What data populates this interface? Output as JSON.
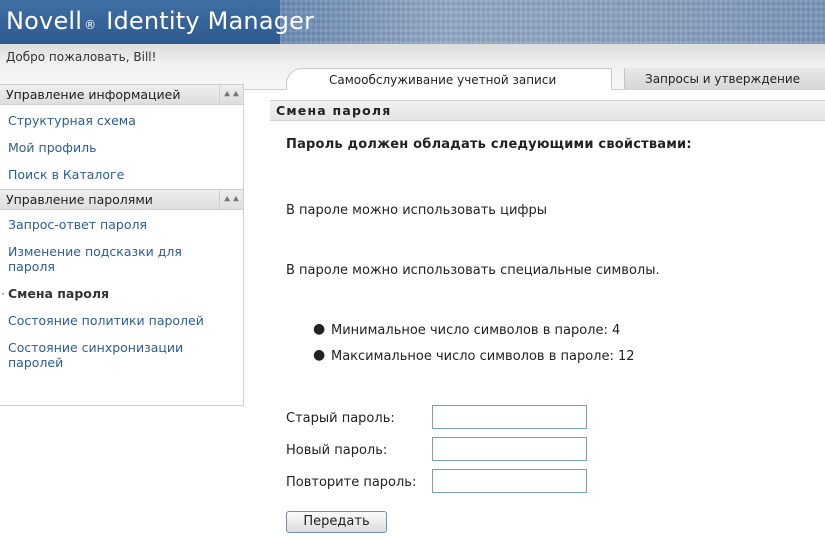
{
  "header": {
    "brand_name": "Novell",
    "brand_reg": "®",
    "brand_product": "Identity Manager"
  },
  "welcome": "Добро пожаловать, Bill!",
  "tabs": [
    {
      "label": "Самообслуживание учетной записи",
      "active": true
    },
    {
      "label": "Запросы и утверждение",
      "active": false
    }
  ],
  "sidebar": {
    "sections": [
      {
        "title": "Управление информацией",
        "items": [
          "Структурная схема",
          "Мой профиль",
          "Поиск в Каталоге"
        ]
      },
      {
        "title": "Управление паролями",
        "items": [
          "Запрос-ответ пароля",
          "Изменение подсказки для пароля",
          "Смена пароля",
          "Состояние политики паролей",
          "Состояние синхронизации паролей"
        ]
      }
    ],
    "current_item": "Смена пароля"
  },
  "panel": {
    "title": "Смена пароля",
    "requirements_heading": "Пароль должен обладать следующими свойствами:",
    "rule_digits": "В пароле можно использовать цифры",
    "rule_special": "В пароле можно использовать специальные символы.",
    "bullets": [
      "Минимальное число символов в пароле: 4",
      "Максимальное число символов в пароле: 12"
    ],
    "old_password_label": "Старый пароль:",
    "new_password_label": "Новый пароль:",
    "repeat_password_label": "Повторите пароль:",
    "old_password_value": "",
    "new_password_value": "",
    "repeat_password_value": "",
    "submit_label": "Передать"
  }
}
